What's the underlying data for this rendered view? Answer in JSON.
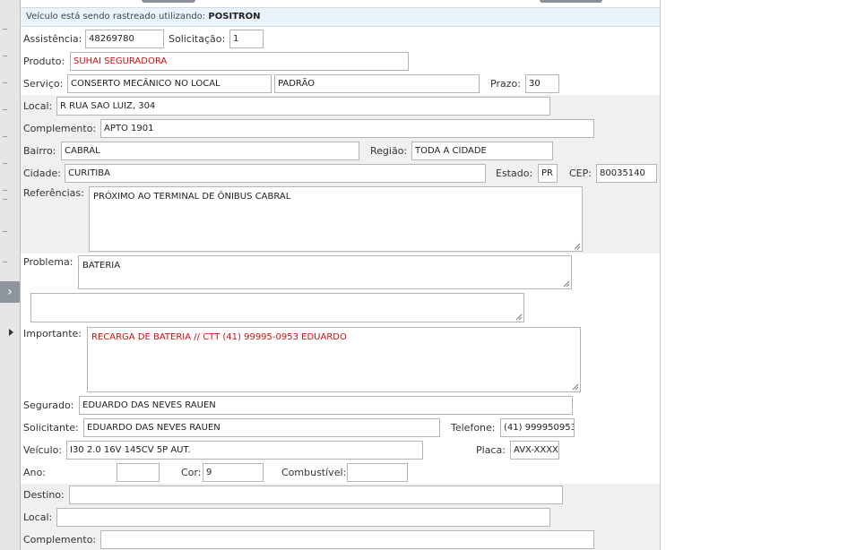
{
  "tracking": {
    "prefix": "Veículo está sendo rastreado utilizando:",
    "provider": "POSITRON"
  },
  "form": {
    "assistencia": {
      "label": "Assistência:",
      "value": "48269780"
    },
    "solicitacao": {
      "label": "Solicitação:",
      "value": "1"
    },
    "produto": {
      "label": "Produto:",
      "value": "SUHAI SEGURADORA"
    },
    "servico": {
      "label": "Serviço:",
      "value": "CONSERTO MECÂNICO NO LOCAL",
      "value2": "PADRÃO"
    },
    "prazo": {
      "label": "Prazo:",
      "value": "30"
    },
    "local": {
      "label": "Local:",
      "value": "R RUA SAO LUIZ, 304"
    },
    "complemento": {
      "label": "Complemento:",
      "value": "APTO 1901"
    },
    "bairro": {
      "label": "Bairro:",
      "value": "CABRAL"
    },
    "regiao": {
      "label": "Região:",
      "value": "TODA A CIDADE"
    },
    "cidade": {
      "label": "Cidade:",
      "value": "CURITIBA"
    },
    "estado": {
      "label": "Estado:",
      "value": "PR"
    },
    "cep": {
      "label": "CEP:",
      "value": "80035140"
    },
    "referencias": {
      "label": "Referências:",
      "value": "PRÓXIMO AO TERMINAL DE ÔNIBUS CABRAL"
    },
    "problema": {
      "label": "Problema:",
      "value": "BATERIA",
      "extra": ""
    },
    "importante": {
      "label": "Importante:",
      "value": "RECARGA DE BATERIA // CTT (41) 99995-0953 EDUARDO"
    },
    "segurado": {
      "label": "Segurado:",
      "value": "EDUARDO DAS NEVES RAUEN"
    },
    "solicitante": {
      "label": "Solicitante:",
      "value": "EDUARDO DAS NEVES RAUEN"
    },
    "telefone": {
      "label": "Telefone:",
      "value": "(41) 999950953"
    },
    "veiculo": {
      "label": "Veículo:",
      "value": "I30 2.0 16V 145CV 5P AUT."
    },
    "placa": {
      "label": "Placa:",
      "value": "AVX-XXXX"
    },
    "ano": {
      "label": "Ano:",
      "value": ""
    },
    "cor": {
      "label": "Cor:",
      "value": "9"
    },
    "combustivel": {
      "label": "Combustível:",
      "value": ""
    },
    "destino": {
      "label": "Destino:",
      "value": ""
    },
    "destino_local": {
      "label": "Local:",
      "value": ""
    },
    "destino_complemento": {
      "label": "Complemento:",
      "value": ""
    }
  },
  "icons": {
    "expand": "chevron-right-icon",
    "pointer": "triangle-right-icon"
  },
  "colors": {
    "important_text": "#d01010",
    "tracking_bar": "#eaf2fa",
    "band": "#f0f0f0"
  }
}
